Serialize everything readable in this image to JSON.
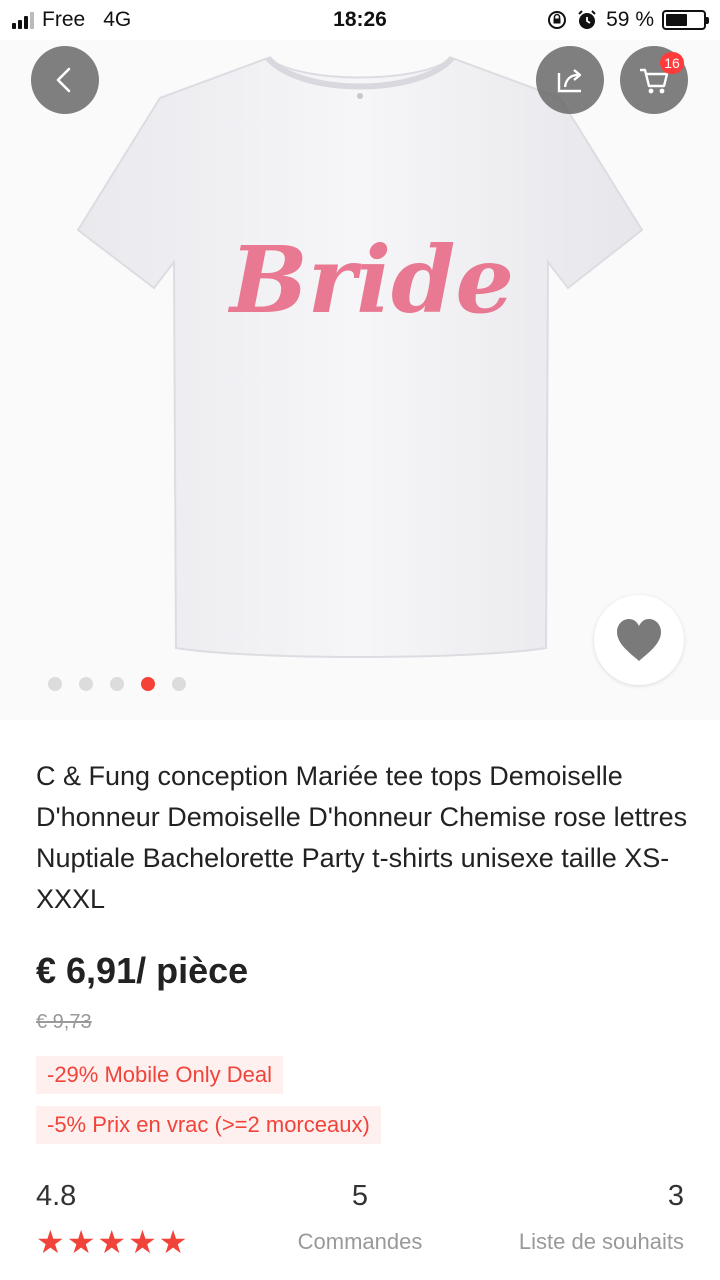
{
  "status_bar": {
    "carrier": "Free",
    "network": "4G",
    "time": "18:26",
    "battery": "59 %",
    "battery_level": 0.59
  },
  "product_image": {
    "print_text": "Bride",
    "print_color": "#e97892",
    "cart_count": "16",
    "slide_count": 5,
    "active_slide": 3,
    "icons": [
      "back-arrow-icon",
      "share-icon",
      "cart-icon",
      "heart-icon"
    ]
  },
  "product": {
    "title": "C & Fung conception Mariée tee tops Demoiselle D'honneur Demoiselle D'honneur Chemise rose lettres Nuptiale Bachelorette Party t-shirts unisexe taille XS-XXXL",
    "price": "€ 6,91/ pièce",
    "old_price": "€ 9,73",
    "deals": [
      "-29% Mobile Only Deal",
      "-5% Prix en vrac (>=2 morceaux)"
    ]
  },
  "stats": {
    "rating": "4.8",
    "stars": 5,
    "orders": "5",
    "orders_label": "Commandes",
    "wishlist": "3",
    "wishlist_label": "Liste de souhaits"
  },
  "colors": {
    "accent": "#f44336",
    "deal_text": "#f0443a",
    "deal_bg": "#fff0f0"
  }
}
